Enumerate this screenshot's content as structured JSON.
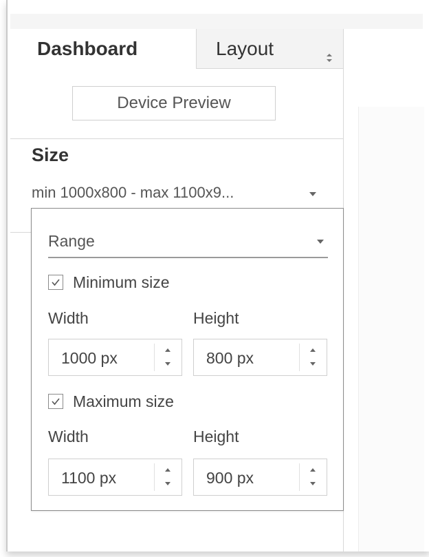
{
  "tabs": [
    {
      "label": "Dashboard",
      "active": true
    },
    {
      "label": "Layout",
      "active": false
    }
  ],
  "device_preview_label": "Device Preview",
  "size": {
    "title": "Size",
    "summary": "min 1000x800 - max 1100x9..."
  },
  "popup": {
    "mode": "Range",
    "minimum": {
      "label": "Minimum size",
      "checked": true,
      "width_label": "Width",
      "height_label": "Height",
      "width_value": "1000 px",
      "height_value": "800 px"
    },
    "maximum": {
      "label": "Maximum size",
      "checked": true,
      "width_label": "Width",
      "height_label": "Height",
      "width_value": "1100 px",
      "height_value": "900 px"
    }
  },
  "colors": {
    "text": "#333333",
    "border": "#cfcfcf",
    "popup_border": "#8c8c8c",
    "inactive_tab_bg": "#f3f3f3"
  },
  "icons": [
    "updown-arrows-icon",
    "dropdown-caret-icon",
    "checkmark-icon",
    "stepper-up-icon",
    "stepper-down-icon"
  ]
}
